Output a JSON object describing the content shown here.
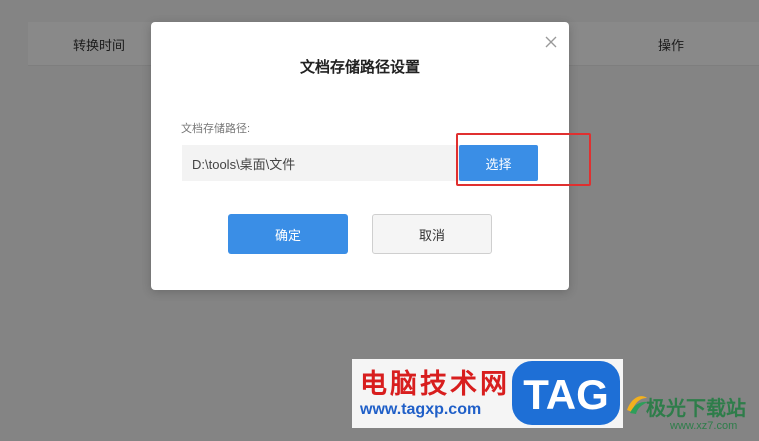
{
  "background": {
    "columns": {
      "time": "转换时间",
      "operations": "操作"
    }
  },
  "dialog": {
    "title": "文档存储路径设置",
    "field_label": "文档存储路径:",
    "path_value": "D:\\tools\\桌面\\文件",
    "choose_label": "选择",
    "ok_label": "确定",
    "cancel_label": "取消",
    "close_icon": "close-icon"
  },
  "watermark": {
    "title": "电脑技术网",
    "url": "www.tagxp.com",
    "logo_text": "TAG",
    "site_name": "极光下载站",
    "site_url": "www.xz7.com"
  },
  "colors": {
    "accent": "#3a8ee6",
    "highlight": "#e03030",
    "watermark_red": "#d81e1e",
    "watermark_blue": "#1f5fc8",
    "watermark_green": "#2e7d4a"
  }
}
